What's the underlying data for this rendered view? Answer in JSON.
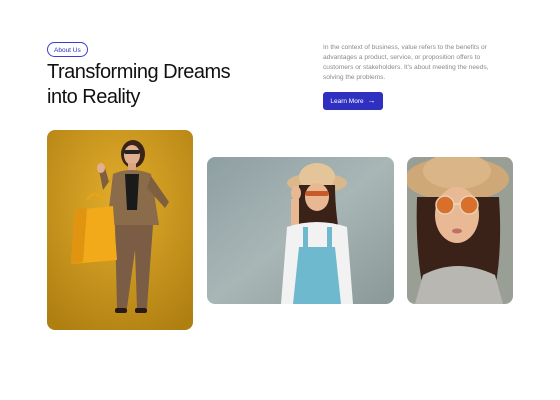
{
  "hero": {
    "badge": "About Us",
    "title_line1": "Transforming Dreams",
    "title_line2": "into Reality",
    "description": "In the context of business, value refers to the benefits or advantages a product, service, or proposition offers to customers or stakeholders. It's about meeting the needs, solving the problems.",
    "cta_label": "Learn More",
    "cta_icon": "arrow-right-icon"
  },
  "colors": {
    "accent": "#3030c0",
    "photo1_bg": "#c7951c",
    "photo2_bg": "#93a3a6",
    "photo3_bg": "#9a9f96"
  }
}
